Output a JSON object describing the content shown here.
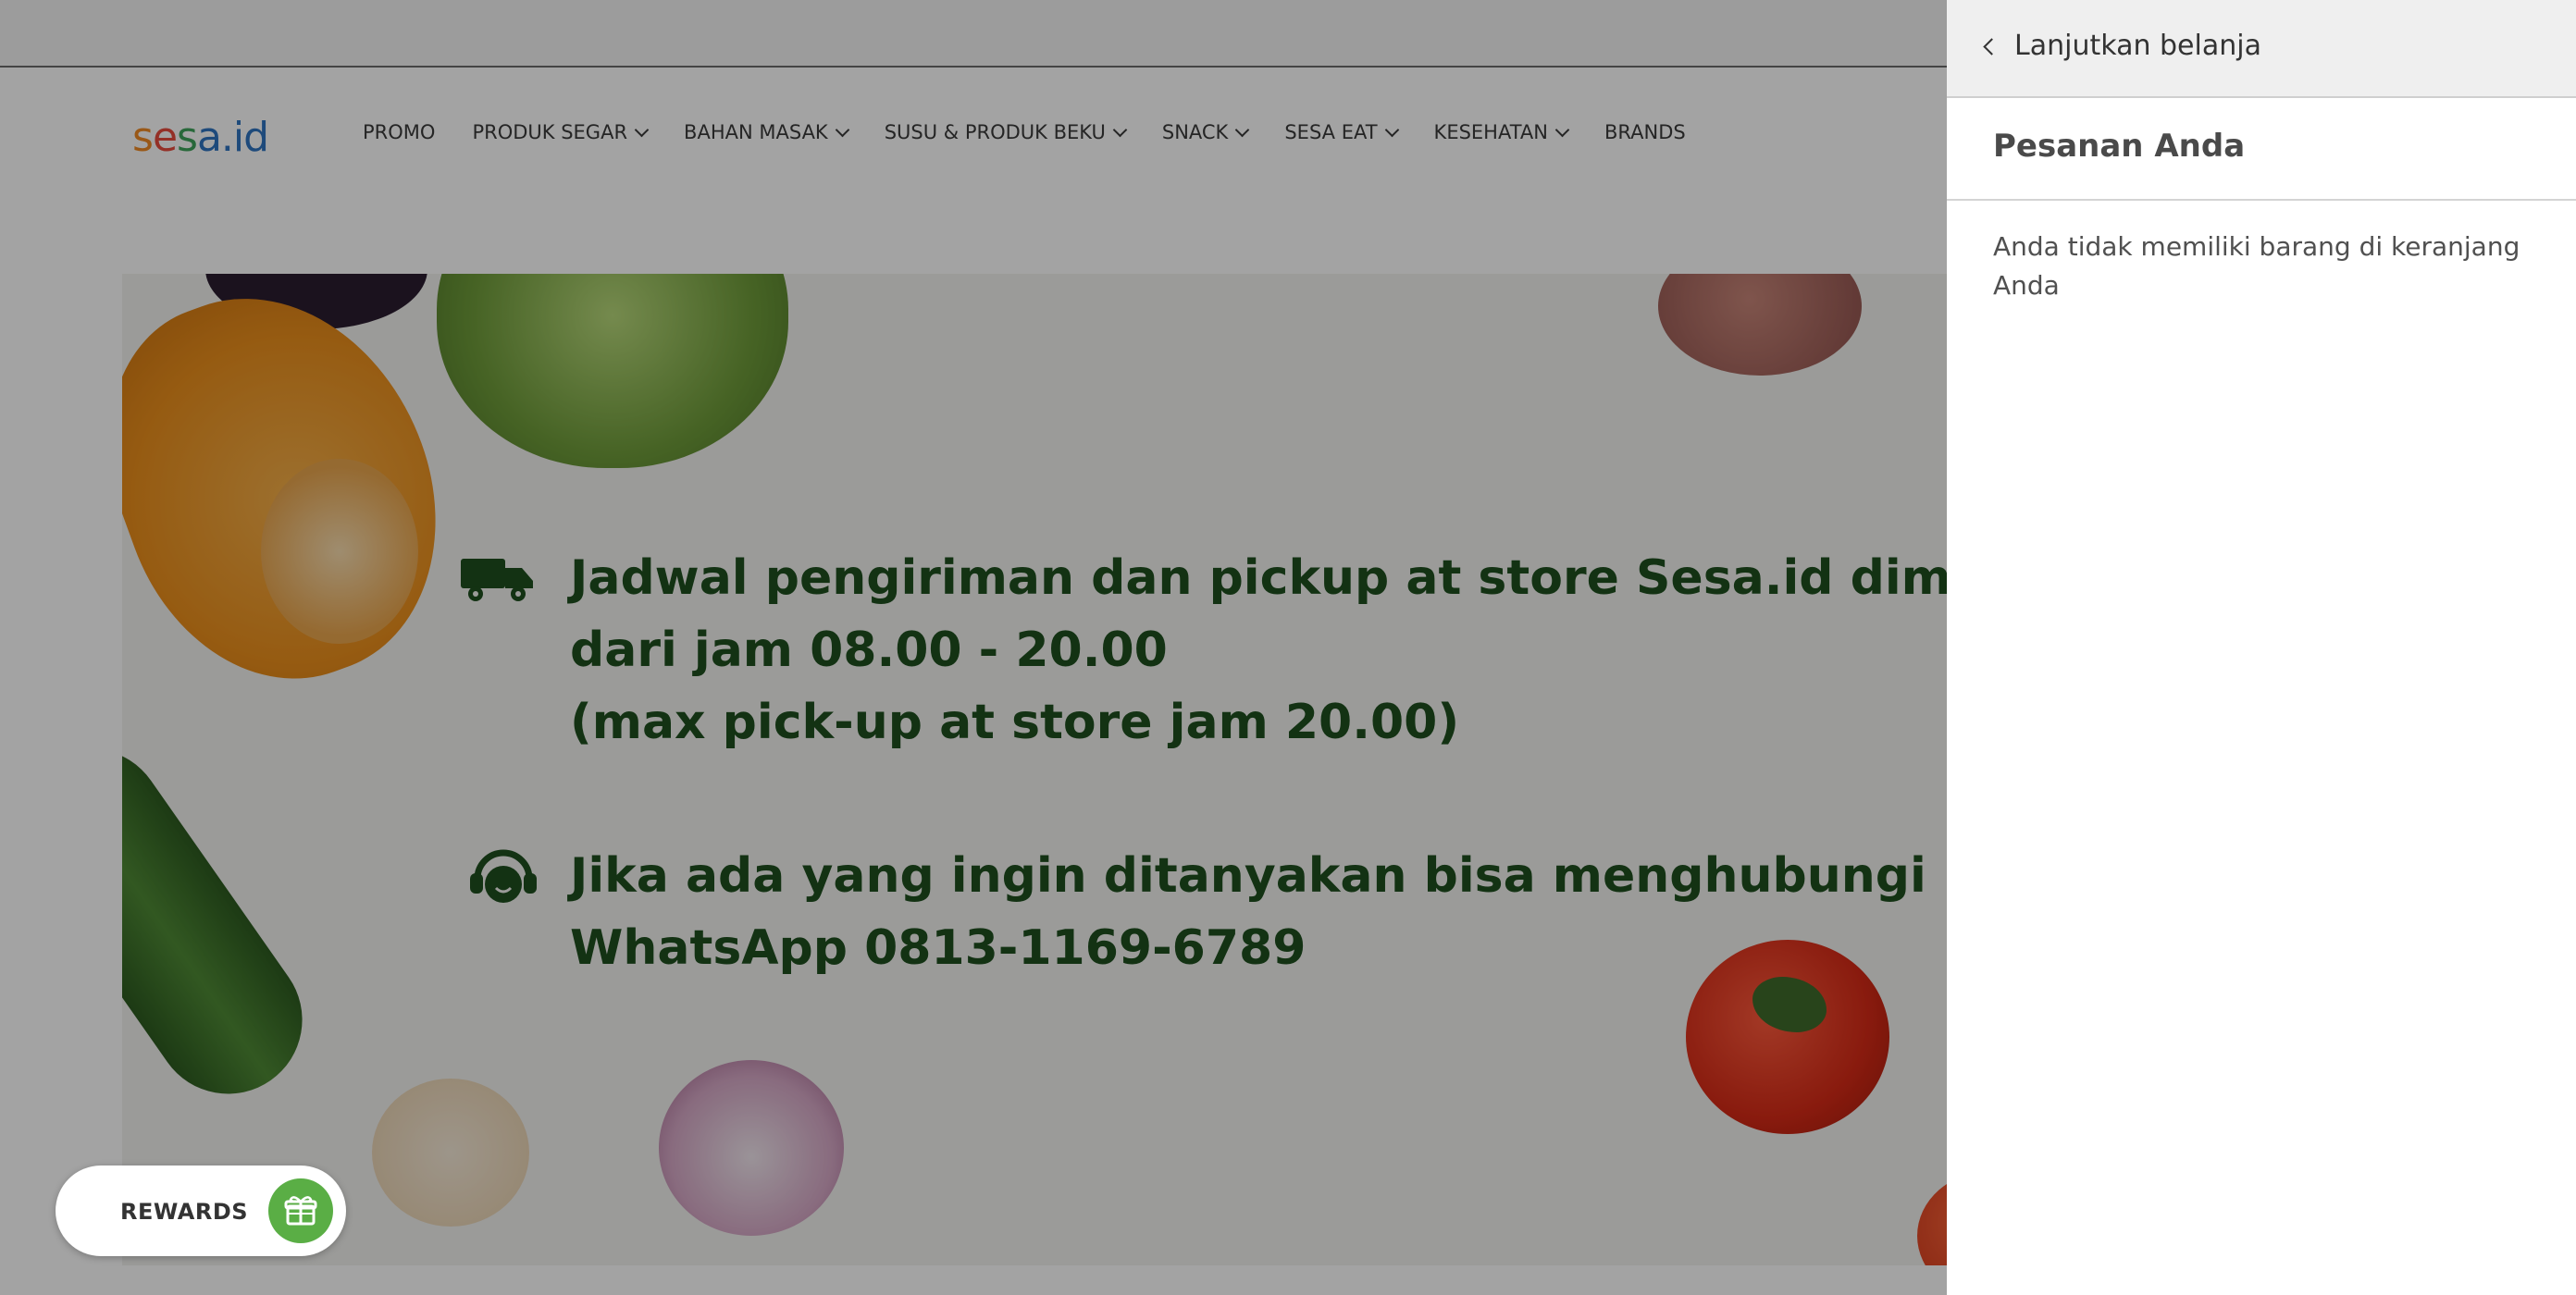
{
  "header": {
    "logo_text": "sesa.id",
    "nav": [
      {
        "label": "PROMO",
        "has_dropdown": false
      },
      {
        "label": "PRODUK SEGAR",
        "has_dropdown": true
      },
      {
        "label": "BAHAN MASAK",
        "has_dropdown": true
      },
      {
        "label": "SUSU & PRODUK BEKU",
        "has_dropdown": true
      },
      {
        "label": "SNACK",
        "has_dropdown": true
      },
      {
        "label": "SESA EAT",
        "has_dropdown": true
      },
      {
        "label": "KESEHATAN",
        "has_dropdown": true
      },
      {
        "label": "BRANDS",
        "has_dropdown": false
      }
    ]
  },
  "banner": {
    "line1": "Jadwal pengiriman dan pickup at store Sesa.id dimulai",
    "line2": "dari jam 08.00 - 20.00",
    "line3": "(max pick-up at store jam 20.00)",
    "line4": "Jika ada yang ingin ditanyakan bisa menghubungi ke CS ka",
    "line5": "WhatsApp 0813-1169-6789"
  },
  "rewards": {
    "label": "REWARDS",
    "icon": "gift-icon"
  },
  "cart": {
    "continue_label": "Lanjutkan belanja",
    "title": "Pesanan Anda",
    "empty_message": "Anda tidak memiliki barang di keranjang Anda"
  },
  "colors": {
    "banner_text": "#1e4f1e",
    "rewards_button": "#5aae45",
    "overlay": "rgba(0,0,0,0.36)"
  }
}
